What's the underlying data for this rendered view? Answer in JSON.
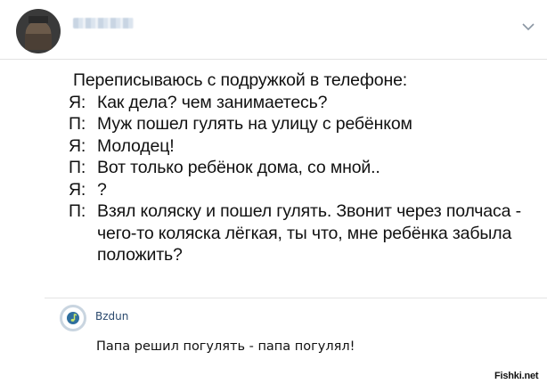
{
  "post": {
    "intro": "Переписываюсь с подружкой в телефоне:",
    "dialogue": [
      {
        "speaker": "Я:",
        "text": "Как дела? чем занимаетесь?"
      },
      {
        "speaker": "П:",
        "text": "Муж пошел гулять на улицу с ребёнком"
      },
      {
        "speaker": "Я:",
        "text": "Молодец!"
      },
      {
        "speaker": "П:",
        "text": "Вот только ребёнок дома, со мной.."
      },
      {
        "speaker": "Я:",
        "text": "?"
      },
      {
        "speaker": "П:",
        "text": "Взял коляску и пошел гулять. Звонит через полчаса - чего-то коляска лёгкая, ты что, мне ребёнка забыла положить?"
      }
    ]
  },
  "comment": {
    "author": "Bzdun",
    "text": "Папа решил погулять - папа погулял!"
  },
  "watermark": "Fishki.net",
  "icons": {
    "header_menu": "chevron-down-icon",
    "comment_avatar": "music-note-icon"
  },
  "colors": {
    "author_link": "#2b4a6e",
    "divider": "#e2e2e2"
  }
}
